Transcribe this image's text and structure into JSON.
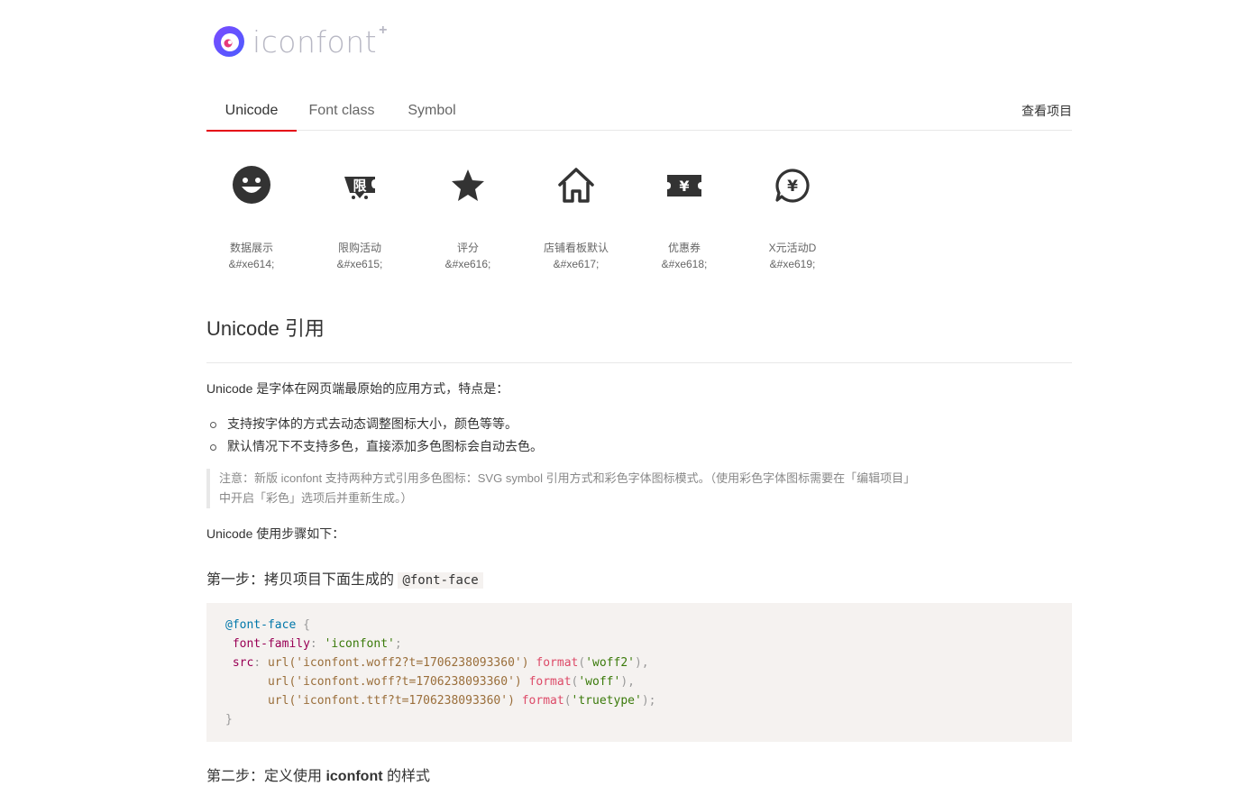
{
  "logo": {
    "text": "iconfont",
    "plus": "+"
  },
  "tabs": [
    {
      "label": "Unicode",
      "active": true
    },
    {
      "label": "Font class",
      "active": false
    },
    {
      "label": "Symbol",
      "active": false
    }
  ],
  "project_link": "查看项目",
  "icons": [
    {
      "name": "数据展示",
      "code": "&#xe614;",
      "icon": "smiley-face-icon"
    },
    {
      "name": "限购活动",
      "code": "&#xe615;",
      "icon": "limited-purchase-icon"
    },
    {
      "name": "评分",
      "code": "&#xe616;",
      "icon": "star-icon"
    },
    {
      "name": "店铺看板默认",
      "code": "&#xe617;",
      "icon": "home-icon"
    },
    {
      "name": "优惠券",
      "code": "&#xe618;",
      "icon": "coupon-icon"
    },
    {
      "name": "X元活动D",
      "code": "&#xe619;",
      "icon": "yuan-chat-icon"
    }
  ],
  "article": {
    "title": "Unicode 引用",
    "intro": "Unicode 是字体在网页端最原始的应用方式，特点是：",
    "bullets": [
      "支持按字体的方式去动态调整图标大小，颜色等等。",
      "默认情况下不支持多色，直接添加多色图标会自动去色。"
    ],
    "note_line1": "注意：新版 iconfont 支持两种方式引用多色图标：SVG symbol 引用方式和彩色字体图标模式。（使用彩色字体图标需要在「编辑项目」",
    "note_line2": "中开启「彩色」选项后并重新生成。）",
    "usage": "Unicode 使用步骤如下：",
    "step1_text": "第一步：拷贝项目下面生成的 ",
    "step1_code": "@font-face",
    "step2_text": "第二步：定义使用 ",
    "step2_bold": "iconfont",
    "step2_tail": " 的样式"
  },
  "code": {
    "selector": "@font-face",
    "open": "{",
    "close": "}",
    "prop1": "font-family",
    "val1": "'iconfont'",
    "prop2": "src",
    "url1": "url('iconfont.woff2?t=1706238093360')",
    "fmt1": "'woff2'",
    "url2": "url('iconfont.woff?t=1706238093360')",
    "fmt2": "'woff'",
    "url3": "url('iconfont.ttf?t=1706238093360')",
    "fmt3": "'truetype'",
    "format_fn": "format"
  }
}
